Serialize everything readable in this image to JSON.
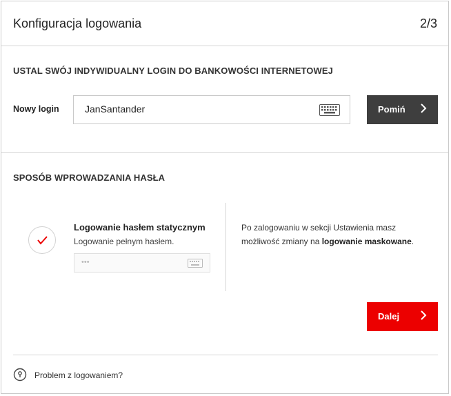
{
  "header": {
    "title": "Konfiguracja logowania",
    "step": "2/3"
  },
  "login_section": {
    "heading": "USTAL SWÓJ INDYWIDUALNY LOGIN DO BANKOWOŚCI INTERNETOWEJ",
    "label": "Nowy login",
    "input_value": "JanSantander",
    "keyboard_icon": "keyboard-icon",
    "skip_button": "Pomiń"
  },
  "password_section": {
    "heading": "SPOSÓB WPROWADZANIA HASŁA",
    "option_title": "Logowanie hasłem statycznym",
    "option_subtitle": "Logowanie pełnym hasłem.",
    "password_placeholder": "•••",
    "info_text": "Po zalogowaniu w sekcji Ustawienia masz możliwość zmiany na ",
    "info_bold": "logowanie maskowane",
    "info_end": ".",
    "next_button": "Dalej"
  },
  "footer": {
    "help_link": "Problem z logowaniem?"
  },
  "colors": {
    "primary_red": "#ec0000",
    "dark_button": "#3e3e3e",
    "border": "#d4d4d4"
  }
}
